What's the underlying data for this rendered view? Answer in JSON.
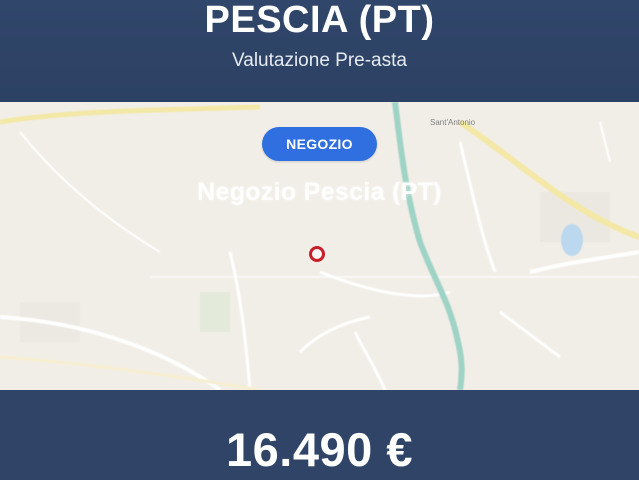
{
  "header": {
    "title": "PESCIA (PT)",
    "subtitle": "Valutazione Pre-asta"
  },
  "map": {
    "badge_label": "NEGOZIO",
    "overlay_title": "Negozio Pescia (PT)",
    "place_label": "Sant'Antonio",
    "pin_icon": "location-pin-icon"
  },
  "footer": {
    "price": "16.490 €"
  },
  "colors": {
    "header_bg": "#30466a",
    "badge_bg": "#2f6fe0",
    "pin": "#c8202a",
    "map_bg": "#f1eee7",
    "river": "#9fd3c6"
  }
}
